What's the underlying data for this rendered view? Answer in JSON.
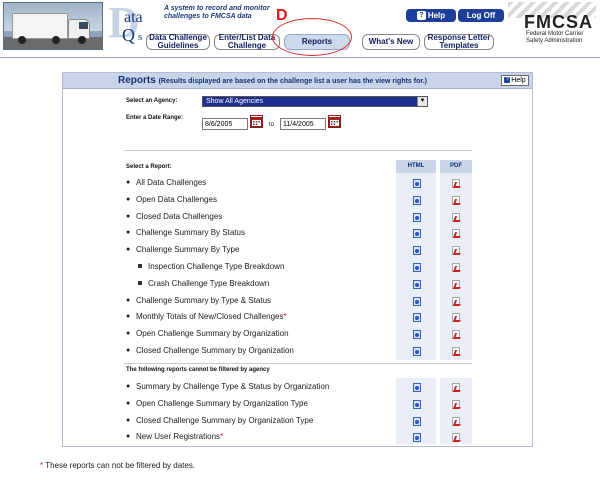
{
  "header": {
    "logo": {
      "big": "D",
      "upper": "ata",
      "lower": "Q",
      "suffix": "s"
    },
    "tagline": "A system to record and monitor challenges to FMCSA data",
    "marker": "D",
    "help_label": "Help",
    "logoff_label": "Log Off",
    "fmcsa_name": "FMCSA",
    "fmcsa_sub": "Federal Motor Carrier Safety Administration",
    "tabs": [
      {
        "label": "Data Challenge Guidelines"
      },
      {
        "label": "Enter/List Data Challenge"
      },
      {
        "label": "Reports"
      },
      {
        "label": "What's New"
      },
      {
        "label": "Response Letter Templates"
      }
    ],
    "active_tab": "Reports"
  },
  "panel": {
    "title": "Reports",
    "title_note": "(Results displayed are based on the challenge list a user has the view rights for.)",
    "help_label": "Help",
    "agency_label": "Select an Agency:",
    "agency_value": "Show All Agencies",
    "date_label": "Enter a Date Range:",
    "date_from": "8/6/2005",
    "date_to_word": "to",
    "date_to": "11/4/2005",
    "report_label": "Select a Report:",
    "col_html": "HTML",
    "col_pdf": "PDF",
    "reports": [
      {
        "label": "All Data Challenges",
        "level": 1,
        "asterisk": ""
      },
      {
        "label": "Open Data Challenges",
        "level": 1,
        "asterisk": ""
      },
      {
        "label": "Closed Data Challenges",
        "level": 1,
        "asterisk": ""
      },
      {
        "label": "Challenge Summary By Status",
        "level": 1,
        "asterisk": ""
      },
      {
        "label": "Challenge Summary By Type",
        "level": 1,
        "asterisk": ""
      },
      {
        "label": "Inspection Challenge Type Breakdown",
        "level": 2,
        "asterisk": ""
      },
      {
        "label": "Crash Challenge Type Breakdown",
        "level": 2,
        "asterisk": ""
      },
      {
        "label": "Challenge Summary by Type & Status",
        "level": 1,
        "asterisk": ""
      },
      {
        "label": "Monthly Totals of New/Closed Challenges",
        "level": 1,
        "asterisk": "*"
      },
      {
        "label": "Open Challenge Summary  by Organization",
        "level": 1,
        "asterisk": ""
      },
      {
        "label": "Closed Challenge Summary by Organization",
        "level": 1,
        "asterisk": ""
      }
    ],
    "unfiltered_label": "The following reports cannot be filtered by agency",
    "unfiltered_reports": [
      {
        "label": "Summary by Challenge Type & Status by Organization",
        "asterisk": ""
      },
      {
        "label": "Open Challenge Summary by Organization Type",
        "asterisk": ""
      },
      {
        "label": "Closed Challenge Summary by Organization Type",
        "asterisk": ""
      },
      {
        "label": "New User Registrations",
        "asterisk": "*"
      }
    ]
  },
  "footnote": {
    "star": "*",
    "text": " These reports can not be filtered by dates."
  }
}
